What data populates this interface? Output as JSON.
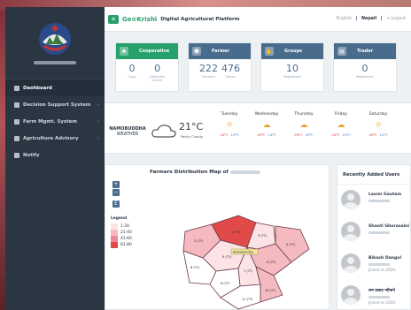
{
  "app": {
    "brand_prefix": "Ge",
    "brand_suffix": "Krishi",
    "brand": "GeoKrishi",
    "platform_title": "Digital Agricultural Platform"
  },
  "header": {
    "lang_english": "English",
    "lang_sep": "|",
    "lang_nepali": "Nepali",
    "logout": "Logout",
    "menu_icon": "hamburger-icon"
  },
  "sidebar": {
    "items": [
      {
        "label": "Dashboard",
        "icon": "grid-icon",
        "active": true
      },
      {
        "label": "Decision Support System",
        "icon": "chart-icon",
        "has_children": true
      },
      {
        "label": "Farm Mgmt. System",
        "icon": "home-icon",
        "has_children": true
      },
      {
        "label": "Agriculture Advisory",
        "icon": "chat-icon",
        "has_children": true
      },
      {
        "label": "Notify",
        "icon": "megaphone-icon"
      }
    ]
  },
  "cards": [
    {
      "title": "Cooperative",
      "color": "#27a06b",
      "icon": "handshake-icon",
      "stats": [
        {
          "value": "0",
          "label": "Coop"
        },
        {
          "value": "0",
          "label": "Collection Center"
        }
      ]
    },
    {
      "title": "Farmer",
      "color": "#4a6c8c",
      "icon": "farmer-icon",
      "stats": [
        {
          "value": "222",
          "label": "Farmers"
        },
        {
          "value": "476",
          "label": "Farms"
        }
      ]
    },
    {
      "title": "Groups",
      "color": "#4a6c8c",
      "icon": "group-icon",
      "stats": [
        {
          "value": "10",
          "label": "Registered"
        }
      ]
    },
    {
      "title": "Trader",
      "color": "#4a6c8c",
      "icon": "shop-icon",
      "stats": [
        {
          "value": "0",
          "label": "Registered"
        }
      ]
    }
  ],
  "weather": {
    "location_line1": "NAMOBUDDHA",
    "location_line2": "WEATHER",
    "temperature": "21°C",
    "condition": "Partly Cloudy",
    "forecast": [
      {
        "day": "Tuesday",
        "high": "26ºC",
        "low": "15ºC",
        "icon": "sun-icon"
      },
      {
        "day": "Wednesday",
        "high": "26ºC",
        "low": "14ºC",
        "icon": "cloud-icon"
      },
      {
        "day": "Thursday",
        "high": "26ºC",
        "low": "16ºC",
        "icon": "cloud-icon"
      },
      {
        "day": "Friday",
        "high": "26ºC",
        "low": "15ºC",
        "icon": "cloud-icon"
      },
      {
        "day": "Saturday",
        "high": "26ºC",
        "low": "15ºC",
        "icon": "sun-icon"
      }
    ]
  },
  "map": {
    "title": "Farmers Distribution Map of",
    "zoom_in": "+",
    "zoom_out": "−",
    "export": "E",
    "legend_title": "Legend",
    "legend": [
      {
        "label": "1-20",
        "color": "#fbe3e6"
      },
      {
        "label": "21-40",
        "color": "#f5b9c0"
      },
      {
        "label": "41-60",
        "color": "#ee8a94"
      },
      {
        "label": "61-80",
        "color": "#e24a4a"
      }
    ],
    "ward_label": "Namobuddha",
    "wards": [
      {
        "label": "1 (??)",
        "value_band": "61-80"
      },
      {
        "label": "2 (??)",
        "value_band": "21-40"
      },
      {
        "label": "3 (??)",
        "value_band": "1-20"
      },
      {
        "label": "4 (??)",
        "value_band": "21-40"
      },
      {
        "label": "5 (??)",
        "value_band": "1-20"
      },
      {
        "label": "6 (??)",
        "value_band": "1-20"
      },
      {
        "label": "7 (??)",
        "value_band": "1-20"
      },
      {
        "label": "8 (??)",
        "value_band": "1-20"
      },
      {
        "label": "9 (??)",
        "value_band": "21-40"
      },
      {
        "label": "10 (??)",
        "value_band": "21-40"
      },
      {
        "label": "11 (??)",
        "value_band": "1-20"
      }
    ]
  },
  "recent_users": {
    "title": "Recently Added Users",
    "users": [
      {
        "name": "Laxmi Gautam",
        "joined": ""
      },
      {
        "name": "Shanti Ghorasaini",
        "joined": ""
      },
      {
        "name": "Bikash Dangol",
        "joined": "Joined on 2020."
      },
      {
        "name": "राम प्रसाद न्यौपाने",
        "joined": "Joined on 2020."
      }
    ]
  }
}
